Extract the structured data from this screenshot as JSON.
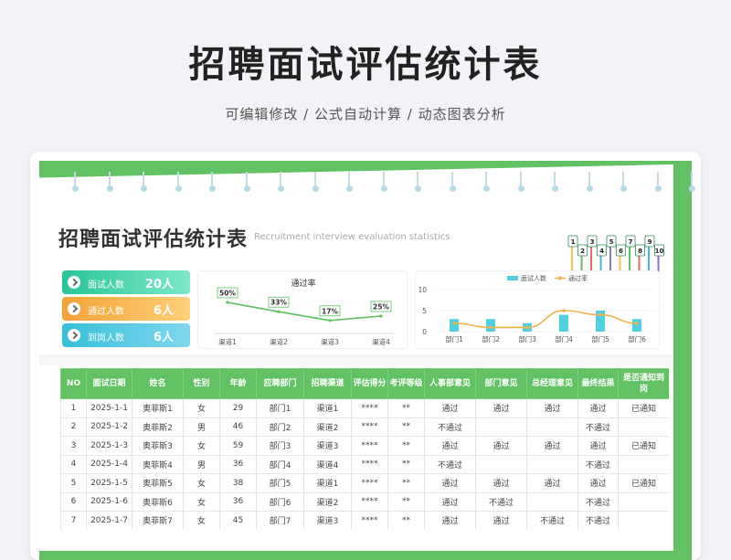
{
  "header": {
    "title": "招聘面试评估统计表",
    "subtitle": "可编辑修改 /  公式自动计算  /  动态图表分析"
  },
  "doc": {
    "title": "招聘面试评估统计表",
    "subtitle": "Recruitment interview evaluation statistics"
  },
  "mascot": {
    "cards": [
      "1",
      "2",
      "3",
      "4",
      "5",
      "6",
      "7",
      "8",
      "9",
      "10"
    ]
  },
  "kpis": [
    {
      "label": "面试人数",
      "value": "20人"
    },
    {
      "label": "通过人数",
      "value": "6人"
    },
    {
      "label": "到岗人数",
      "value": "6人"
    }
  ],
  "colors": {
    "green": "#62c163",
    "line": "#5bbf5e",
    "bar": "#4fd0e0",
    "orange": "#f0b24a"
  },
  "chart_data": [
    {
      "type": "line",
      "title": "通过率",
      "categories": [
        "渠道1",
        "渠道2",
        "渠道3",
        "渠道4"
      ],
      "values": [
        50,
        33,
        17,
        25
      ],
      "labels": [
        "50%",
        "33%",
        "17%",
        "25%"
      ],
      "ylim": [
        0,
        60
      ]
    },
    {
      "type": "bar",
      "categories": [
        "部门1",
        "部门2",
        "部门3",
        "部门4",
        "部门5",
        "部门6"
      ],
      "series": [
        {
          "name": "面试人数",
          "type": "bar",
          "values": [
            3,
            3,
            2,
            4,
            5,
            3
          ]
        },
        {
          "name": "通过率",
          "type": "line",
          "values": [
            2,
            1,
            1,
            5,
            4,
            2
          ]
        }
      ],
      "yticks": [
        "10",
        "5",
        "0"
      ],
      "ylim": [
        0,
        10
      ],
      "legend": "top"
    }
  ],
  "table": {
    "columns": [
      "NO",
      "面试日期",
      "姓名",
      "性别",
      "年龄",
      "应聘部门",
      "招聘渠道",
      "评估得分",
      "考评等级",
      "人事部意见",
      "部门意见",
      "总经理意见",
      "最终结果",
      "是否通知到岗"
    ],
    "rows": [
      [
        "1",
        "2025-1-1",
        "奥菲斯1",
        "女",
        "29",
        "部门1",
        "渠道1",
        "****",
        "**",
        "通过",
        "通过",
        "通过",
        "通过",
        "已通知"
      ],
      [
        "2",
        "2025-1-2",
        "奥菲斯2",
        "男",
        "46",
        "部门2",
        "渠道2",
        "****",
        "**",
        "不通过",
        "",
        "",
        "不通过",
        ""
      ],
      [
        "3",
        "2025-1-3",
        "奥菲斯3",
        "女",
        "59",
        "部门3",
        "渠道3",
        "****",
        "**",
        "通过",
        "通过",
        "通过",
        "通过",
        "已通知"
      ],
      [
        "4",
        "2025-1-4",
        "奥菲斯4",
        "男",
        "36",
        "部门4",
        "渠道4",
        "****",
        "**",
        "不通过",
        "",
        "",
        "不通过",
        ""
      ],
      [
        "5",
        "2025-1-5",
        "奥菲斯5",
        "女",
        "38",
        "部门5",
        "渠道1",
        "****",
        "**",
        "通过",
        "通过",
        "通过",
        "通过",
        "已通知"
      ],
      [
        "6",
        "2025-1-6",
        "奥菲斯6",
        "女",
        "36",
        "部门6",
        "渠道2",
        "****",
        "**",
        "通过",
        "不通过",
        "",
        "不通过",
        ""
      ],
      [
        "7",
        "2025-1-7",
        "奥菲斯7",
        "女",
        "45",
        "部门7",
        "渠道3",
        "****",
        "**",
        "通过",
        "通过",
        "不通过",
        "不通过",
        ""
      ]
    ]
  }
}
